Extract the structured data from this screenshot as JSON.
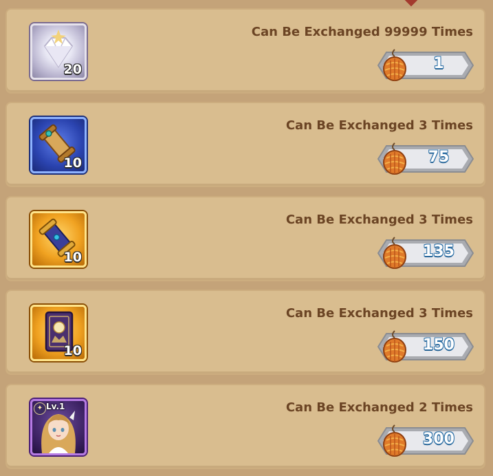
{
  "items": [
    {
      "exchange_text": "Can Be Exchanged 99999 Times",
      "quantity": "20",
      "price": "1",
      "icon": "diamond-icon",
      "frame": "silver"
    },
    {
      "exchange_text": "Can Be Exchanged 3 Times",
      "quantity": "10",
      "price": "75",
      "icon": "blue-scroll-icon",
      "frame": "blue"
    },
    {
      "exchange_text": "Can Be Exchanged 3 Times",
      "quantity": "10",
      "price": "135",
      "icon": "gold-scroll-icon",
      "frame": "gold"
    },
    {
      "exchange_text": "Can Be Exchanged 3 Times",
      "quantity": "10",
      "price": "150",
      "icon": "card-pack-icon",
      "frame": "gold"
    },
    {
      "exchange_text": "Can Be Exchanged 2 Times",
      "level": "Lv.1",
      "price": "300",
      "icon": "hero-portrait-icon",
      "frame": "purple"
    }
  ],
  "currency_icon": "pinecone-fruit-icon",
  "colors": {
    "background": "#c4a379",
    "card": "#d9bd8f",
    "exchange_text": "#6b4424",
    "price_text_outline": "#2b6fa6"
  }
}
